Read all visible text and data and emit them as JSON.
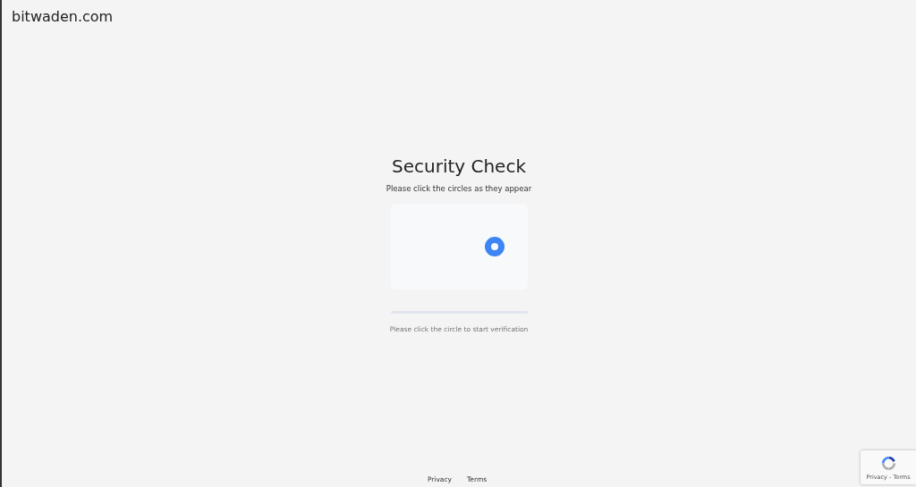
{
  "site": "bitwaden.com",
  "title": "Security Check",
  "instruction": "Please click the circles as they appear",
  "progress": {
    "level": 0
  },
  "hint": "Please click the circle to start verification",
  "footer_links": [
    "Privacy",
    "Terms"
  ],
  "recaptcha_badge": {
    "text": "Privacy - Terms"
  }
}
